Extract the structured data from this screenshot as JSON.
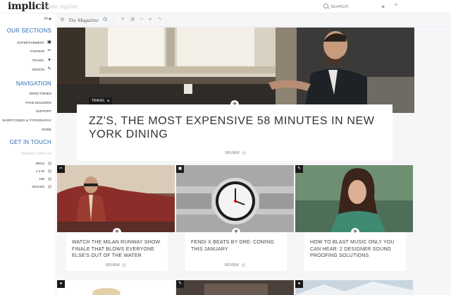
{
  "header": {
    "logo": "implicit",
    "tagline": "Some tagline",
    "search_placeholder": "SEARCH"
  },
  "sidebar": {
    "count": "24 ◆",
    "sections_heading": "OUR SECTIONS",
    "sections": [
      {
        "label": "ENTERTAINMENT",
        "icon": "tv-icon"
      },
      {
        "label": "FASHION",
        "icon": "scissors-icon"
      },
      {
        "label": "TRAVEL",
        "icon": "pin-icon"
      },
      {
        "label": "DESIGN",
        "icon": "pencil-icon"
      }
    ],
    "navigation_heading": "NAVIGATION",
    "navigation": [
      "DIRECTORIES",
      "PAGE BUILDERS",
      "SUPPORT",
      "SHORTCODES & TYPOGRAPHY",
      "MORE"
    ],
    "touch_heading": "GET IN TOUCH",
    "touch_sub": "CONNECT WITH US",
    "stats": [
      "48012",
      "4 2 W",
      "199",
      "2031432"
    ]
  },
  "subnav": {
    "magazine": "The Magazine"
  },
  "hero": {
    "badge": "TRAVEL",
    "title": "ZZ'S, THE MOST EXPENSIVE 58 MINUTES IN NEW YORK DINING",
    "review": "REVIEW"
  },
  "cards": [
    {
      "title": "WATCH THE MILAN RUNWAY SHOW FINALE THAT BLOWS EVERYONE ELSE'S OUT OF THE WATER",
      "review": "REVIEW",
      "icon": "scissors-icon"
    },
    {
      "title": "FENDI X BEATS BY DRE: COMING THIS JANUARY",
      "review": "REVIEW",
      "icon": "tv-icon"
    },
    {
      "title": "HOW TO BLAST MUSIC ONLY YOU CAN HEAR: 2 DESIGNER SOUND PROOFING SOLUTIONS",
      "review": "",
      "icon": "pencil-icon"
    }
  ],
  "colors": {
    "accent": "#2b6bb3",
    "badge_bg": "#1a1a1a",
    "main_bg": "#f6f6f9"
  }
}
